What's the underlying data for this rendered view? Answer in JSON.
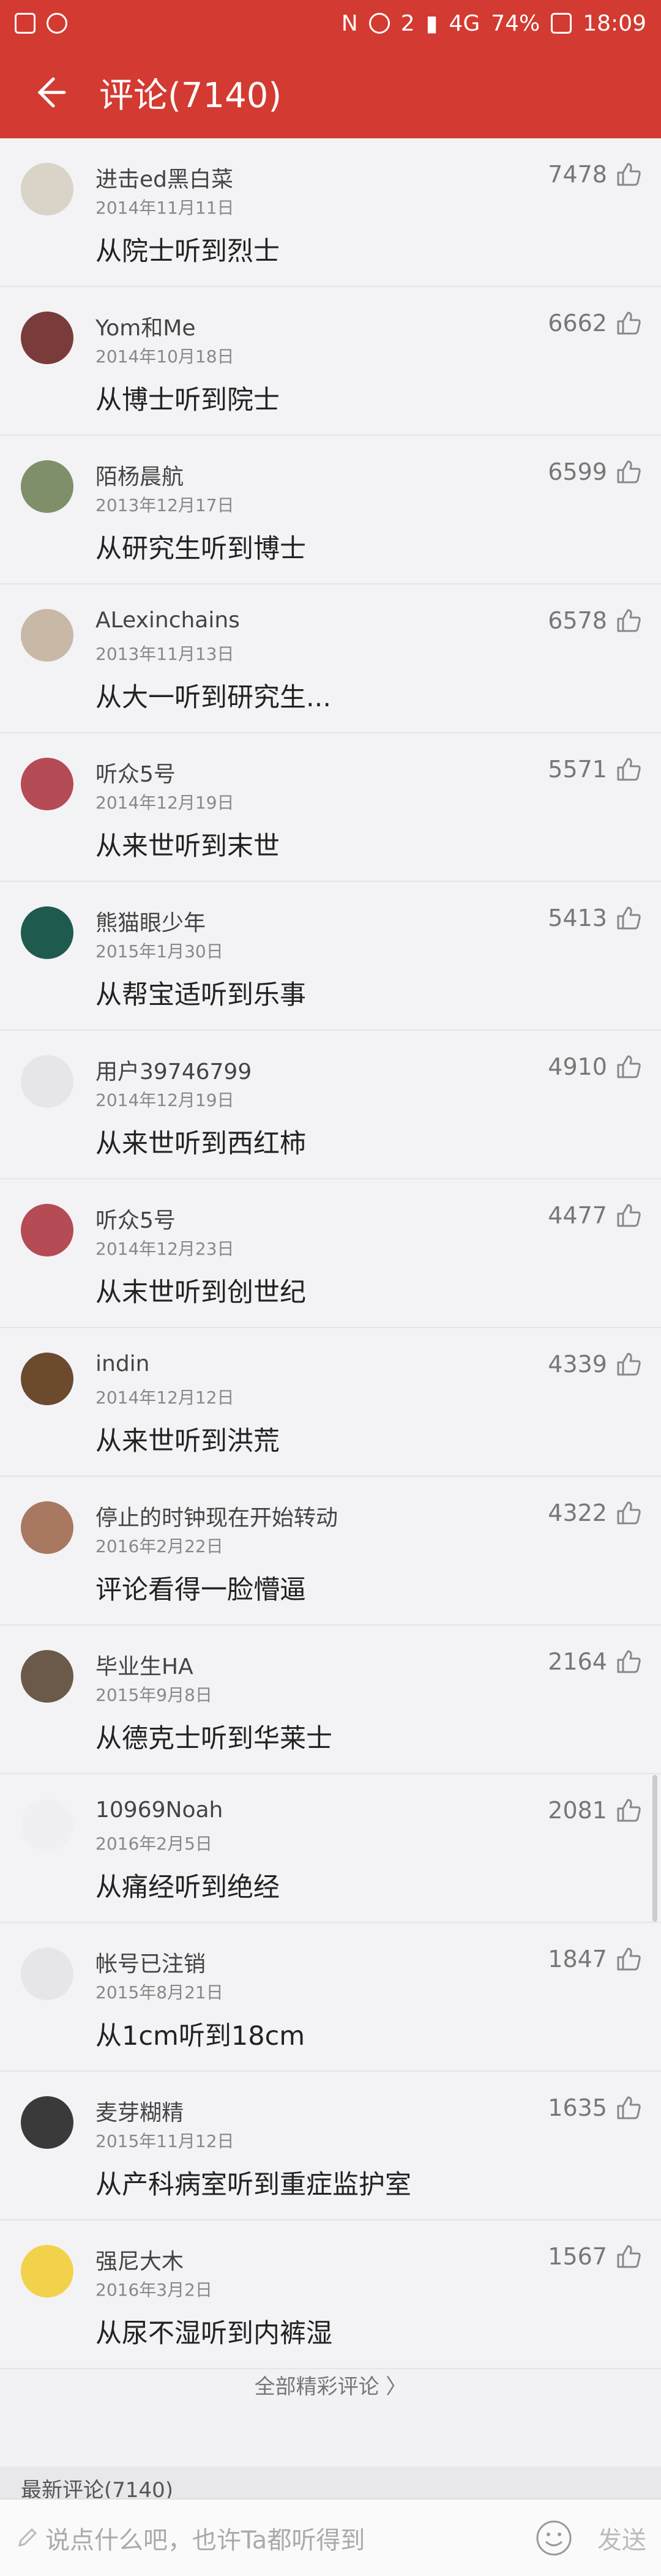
{
  "status_bar": {
    "battery": "74%",
    "time": "18:09",
    "network": "4G",
    "sim": "2"
  },
  "header": {
    "title": "评论(7140)"
  },
  "comments": [
    {
      "name": "进击ed黑白菜",
      "date": "2014年11月11日",
      "content": "从院士听到烈士",
      "likes": "7478",
      "avatar_color": "#d9d3c8"
    },
    {
      "name": "Yom和Me",
      "date": "2014年10月18日",
      "content": "从博士听到院士",
      "likes": "6662",
      "avatar_color": "#7a3b3b"
    },
    {
      "name": "陌杨晨航",
      "date": "2013年12月17日",
      "content": "从研究生听到博士",
      "likes": "6599",
      "avatar_color": "#7f8f6a"
    },
    {
      "name": "ALexinchains",
      "date": "2013年11月13日",
      "content": "从大一听到研究生...",
      "likes": "6578",
      "avatar_color": "#c8b8a6"
    },
    {
      "name": "听众5号",
      "date": "2014年12月19日",
      "content": "从来世听到末世",
      "likes": "5571",
      "avatar_color": "#b54b55"
    },
    {
      "name": "熊猫眼少年",
      "date": "2015年1月30日",
      "content": "从帮宝适听到乐事",
      "likes": "5413",
      "avatar_color": "#1f5a4f"
    },
    {
      "name": "用户39746799",
      "date": "2014年12月19日",
      "content": "从来世听到西红柿",
      "likes": "4910",
      "avatar_color": "#e6e6ea"
    },
    {
      "name": "听众5号",
      "date": "2014年12月23日",
      "content": "从末世听到创世纪",
      "likes": "4477",
      "avatar_color": "#b54b55"
    },
    {
      "name": "indin",
      "date": "2014年12月12日",
      "content": "从来世听到洪荒",
      "likes": "4339",
      "avatar_color": "#6c4a2e"
    },
    {
      "name": "停止的时钟现在开始转动",
      "date": "2016年2月22日",
      "content": "评论看得一脸懵逼",
      "likes": "4322",
      "avatar_color": "#a87860"
    },
    {
      "name": "毕业生HA",
      "date": "2015年9月8日",
      "content": "从德克士听到华莱士",
      "likes": "2164",
      "avatar_color": "#6b5a4a"
    },
    {
      "name": "10969Noah",
      "date": "2016年2月5日",
      "content": "从痛经听到绝经",
      "likes": "2081",
      "avatar_color": "#f0f0f3"
    },
    {
      "name": "帐号已注销",
      "date": "2015年8月21日",
      "content": "从1cm听到18cm",
      "likes": "1847",
      "avatar_color": "#e6e6ea"
    },
    {
      "name": "麦芽糊精",
      "date": "2015年11月12日",
      "content": "从产科病室听到重症监护室",
      "likes": "1635",
      "avatar_color": "#3a3a3a"
    },
    {
      "name": "强尼大木",
      "date": "2016年3月2日",
      "content": "从尿不湿听到内裤湿",
      "likes": "1567",
      "avatar_color": "#f2d24a"
    }
  ],
  "all_comments_link": "全部精彩评论 〉",
  "latest_section": "最新评论(7140)",
  "bottom_bar": {
    "placeholder": "说点什么吧，也许Ta都听得到",
    "send_label": "发送"
  },
  "icons": {
    "back": "back-arrow-icon",
    "like": "thumbs-up-icon",
    "emoji": "smile-icon",
    "edit": "pencil-icon"
  },
  "colors": {
    "accent": "#d33a31",
    "background": "#f2f2f5"
  }
}
